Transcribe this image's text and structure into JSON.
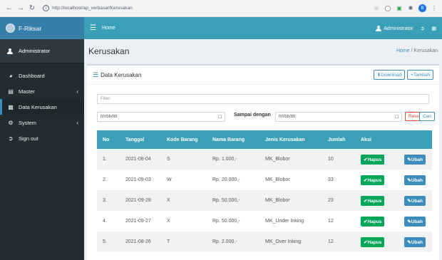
{
  "browser": {
    "url": "http://localhost/ap_verbasar/Kerusakan"
  },
  "brand": {
    "name": "F-Riksar"
  },
  "topbar": {
    "home": "Home",
    "user": "Administrator"
  },
  "sidebar": {
    "user": "Administrator",
    "items": [
      {
        "label": "Dashboard",
        "icon": "dashboard-icon"
      },
      {
        "label": "Master",
        "icon": "database-icon"
      },
      {
        "label": "Data Kerusakan",
        "icon": "car-icon"
      },
      {
        "label": "System",
        "icon": "cogs-icon"
      },
      {
        "label": "Sign out",
        "icon": "sign-out-icon"
      }
    ]
  },
  "page": {
    "title": "Kerusakan",
    "crumb_home": "Home",
    "crumb_current": "Kerusakan"
  },
  "box": {
    "title": "Data Kerusakan",
    "download_label": "Download",
    "tambah_label": "Tambah"
  },
  "filter": {
    "placeholder": "Filter",
    "date_from_placeholder": "hh/bb/tttt",
    "date_to_placeholder": "hh/bb/tttt",
    "between_label": "Sampai dengan",
    "reset_label": "Reset",
    "cari_label": "Cari"
  },
  "table": {
    "headers": [
      "No",
      "Tanggal",
      "Kode Barang",
      "Nama Barang",
      "Jenis Kerusakan",
      "Jumlah",
      "Aksi"
    ],
    "hapus_label": "Hapus",
    "ubah_label": "Ubah",
    "rows": [
      {
        "no": "1.",
        "tanggal": "2021-08-04",
        "kode": "S",
        "nama": "Rp. 1.000,-",
        "jenis": "MK_Blobor",
        "jumlah": "10"
      },
      {
        "no": "2.",
        "tanggal": "2021-09-03",
        "kode": "W",
        "nama": "Rp. 20.000,-",
        "jenis": "MK_Blobor",
        "jumlah": "33"
      },
      {
        "no": "3.",
        "tanggal": "2021-09-28",
        "kode": "X",
        "nama": "Rp. 50.000,-",
        "jenis": "MK_Blobor",
        "jumlah": "23"
      },
      {
        "no": "4.",
        "tanggal": "2021-09-27",
        "kode": "X",
        "nama": "Rp. 50.000,-",
        "jenis": "MK_Under Inking",
        "jumlah": "12"
      },
      {
        "no": "5.",
        "tanggal": "2021-08-26",
        "kode": "T",
        "nama": "Rp. 2.000,-",
        "jenis": "MK_Over Inking",
        "jumlah": "12"
      }
    ]
  }
}
